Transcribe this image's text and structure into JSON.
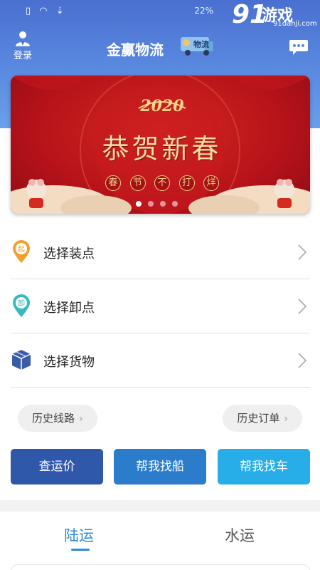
{
  "statusbar": {
    "battery_text": "22%"
  },
  "watermark": {
    "brand_number": "91",
    "brand_text": "游戏",
    "url": "91danji.com"
  },
  "header": {
    "login_label": "登录",
    "title": "金赢物流",
    "logo_text": "物流"
  },
  "banner": {
    "year": "2020",
    "headline": "恭贺新春",
    "subtitle_chars": [
      "春",
      "节",
      "不",
      "打",
      "烊"
    ],
    "slide_count": 4,
    "active_slide": 0
  },
  "menu": {
    "items": [
      {
        "label": "选择装点",
        "icon": "load-point-marker-icon",
        "marker_char": "起",
        "color": "#f0a030"
      },
      {
        "label": "选择卸点",
        "icon": "unload-point-marker-icon",
        "marker_char": "卸",
        "color": "#3ab8c0"
      },
      {
        "label": "选择货物",
        "icon": "cargo-box-icon",
        "color": "#3a5ba8"
      }
    ]
  },
  "history": {
    "routes_label": "历史线路",
    "orders_label": "历史订单"
  },
  "actions": {
    "price_label": "查运价",
    "ship_label": "帮我找船",
    "truck_label": "帮我找车",
    "colors": {
      "price": "#2f58ab",
      "ship": "#2b7dcc",
      "truck": "#27aee8"
    }
  },
  "tabs": {
    "land_label": "陆运",
    "water_label": "水运",
    "active": "land",
    "accent": "#2d8cd6"
  }
}
